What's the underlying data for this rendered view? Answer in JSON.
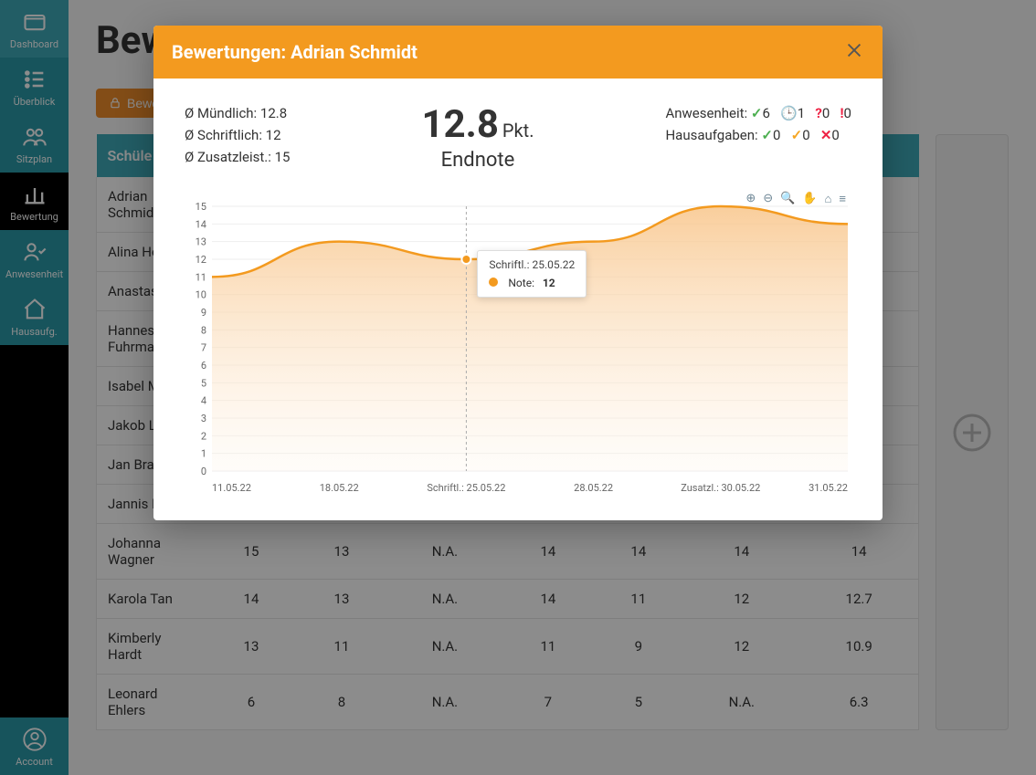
{
  "page": {
    "title": "Bew",
    "button_bewerten": "Bewe"
  },
  "sidebar": {
    "items": [
      {
        "label": "Dashboard"
      },
      {
        "label": "Überblick"
      },
      {
        "label": "Sitzplan"
      },
      {
        "label": "Bewertung"
      },
      {
        "label": "Anwesenheit"
      },
      {
        "label": "Hausaufg."
      }
    ],
    "account": "Account"
  },
  "table": {
    "header": "Schüle",
    "rows": [
      {
        "name": "Adrian Schmidt",
        "cols": [
          "",
          "",
          "",
          "",
          "",
          "",
          ""
        ]
      },
      {
        "name": "Alina Hoffmar",
        "cols": [
          "",
          "",
          "",
          "",
          "",
          "",
          ""
        ]
      },
      {
        "name": "Anastas",
        "cols": [
          "",
          "",
          "",
          "",
          "",
          "",
          ""
        ]
      },
      {
        "name": "Hannes Fuhrmar",
        "cols": [
          "",
          "",
          "",
          "",
          "",
          "",
          ""
        ]
      },
      {
        "name": "Isabel M",
        "cols": [
          "",
          "",
          "",
          "",
          "",
          "",
          ""
        ]
      },
      {
        "name": "Jakob L",
        "cols": [
          "",
          "",
          "",
          "",
          "",
          "",
          ""
        ]
      },
      {
        "name": "Jan Bra",
        "cols": [
          "",
          "",
          "",
          "",
          "",
          "",
          ""
        ]
      },
      {
        "name": "Jannis E",
        "cols": [
          "",
          "",
          "",
          "",
          "",
          "",
          ""
        ]
      },
      {
        "name": "Johanna Wagner",
        "cols": [
          "15",
          "13",
          "N.A.",
          "14",
          "14",
          "14",
          "14"
        ]
      },
      {
        "name": "Karola Tan",
        "cols": [
          "14",
          "13",
          "N.A.",
          "14",
          "11",
          "12",
          "12.7"
        ]
      },
      {
        "name": "Kimberly Hardt",
        "cols": [
          "13",
          "11",
          "N.A.",
          "11",
          "9",
          "12",
          "10.9"
        ]
      },
      {
        "name": "Leonard Ehlers",
        "cols": [
          "6",
          "8",
          "N.A.",
          "7",
          "5",
          "N.A.",
          "6.3"
        ]
      }
    ]
  },
  "modal": {
    "title": "Bewertungen: Adrian Schmidt",
    "muendlich": "Ø Mündlich: 12.8",
    "schriftlich": "Ø Schriftlich: 12",
    "zusatz": "Ø Zusatzleist.: 15",
    "big_score": "12.8",
    "pkt": "Pkt.",
    "endnote": "Endnote",
    "anwesenheit_label": "Anwesenheit:",
    "anwesenheit": {
      "present": "6",
      "late": "1",
      "unknown": "0",
      "missing": "0"
    },
    "hausaufgaben_label": "Hausaufgaben:",
    "hausaufgaben": {
      "done": "0",
      "partial": "0",
      "missing": "0"
    },
    "tooltip": {
      "title": "Schriftl.: 25.05.22",
      "label": "Note:",
      "value": "12"
    }
  },
  "chart_data": {
    "type": "area",
    "title": "",
    "xlabel": "",
    "ylabel": "",
    "ylim": [
      0,
      15
    ],
    "y_ticks": [
      0,
      1,
      2,
      3,
      4,
      5,
      6,
      7,
      8,
      9,
      10,
      11,
      12,
      13,
      14,
      15
    ],
    "x_ticks": [
      "11.05.22",
      "18.05.22",
      "Schriftl.: 25.05.22",
      "28.05.22",
      "Zusatzl.: 30.05.22",
      "31.05.22"
    ],
    "series": [
      {
        "name": "Note",
        "color": "#f39a1f",
        "points": [
          {
            "x": "11.05.22",
            "y": 11
          },
          {
            "x": "18.05.22",
            "y": 13
          },
          {
            "x": "Schriftl.: 25.05.22",
            "y": 12
          },
          {
            "x": "28.05.22",
            "y": 13
          },
          {
            "x": "Zusatzl.: 30.05.22",
            "y": 15
          },
          {
            "x": "31.05.22",
            "y": 14
          }
        ]
      }
    ]
  },
  "toolbar": {
    "zoom_in": "⊕",
    "zoom_out": "⊖",
    "zoom_sel": "🔍",
    "pan": "✋",
    "home": "⌂",
    "menu": "≡"
  }
}
